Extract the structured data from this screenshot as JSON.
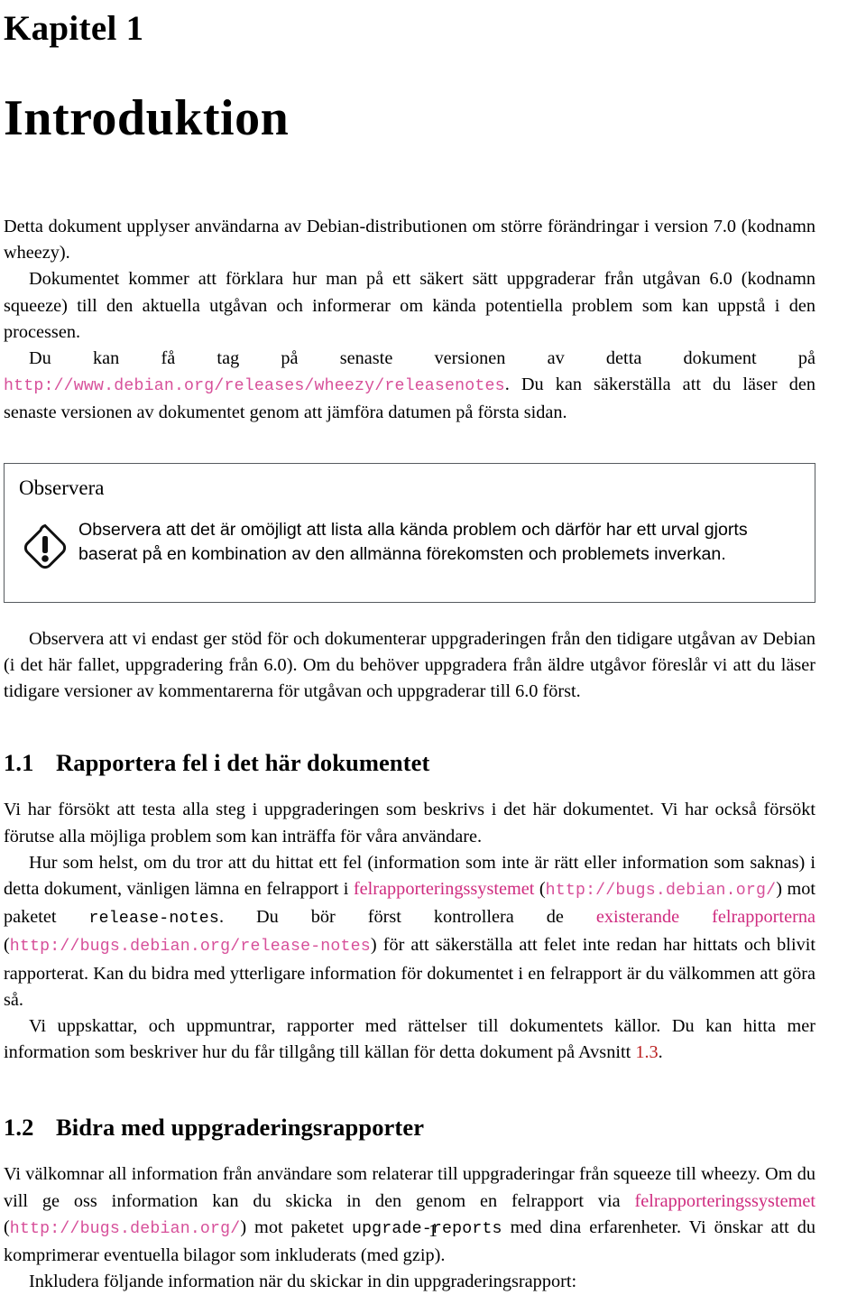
{
  "document": {
    "language": "sv",
    "chapter_label": "Kapitel 1",
    "chapter_title": "Introduktion",
    "page_number": "1"
  },
  "colors": {
    "text": "#000000",
    "url_mono": "#d7509a",
    "link_serif": "#cf2b7f",
    "xref": "#bb2222",
    "note_border": "#555a5e",
    "background": "#ffffff"
  },
  "intro": {
    "para1": {
      "text": "Detta dokument upplyser användarna av Debian-distributionen om större förändringar i version 7.0 (kodnamn wheezy)."
    },
    "para2": {
      "text": "Dokumentet kommer att förklara hur man på ett säkert sätt uppgraderar från utgåvan 6.0 (kodnamn squeeze) till den aktuella utgåvan och informerar om kända potentiella problem som kan uppstå i den processen."
    },
    "para3": {
      "before_url": "Du kan få tag på senaste versionen av detta dokument på ",
      "url": "http://www.debian.org/releases/wheezy/releasenotes",
      "after_url": ". Du kan säkerställa att du läser den senaste versionen av dokumentet genom att jämföra datumen på första sidan."
    }
  },
  "note": {
    "icon_name": "warning-diamond-icon",
    "title": "Observera",
    "body": "Observera att det är omöjligt att lista alla kända problem och därför har ett urval gjorts baserat på en kombination av den allmänna förekomsten och problemets inverkan."
  },
  "after_note": {
    "para": "Observera att vi endast ger stöd för och dokumenterar uppgraderingen från den tidigare utgåvan av Debian (i det här fallet, uppgradering från 6.0). Om du behöver uppgradera från äldre utgåvor föreslår vi att du läser tidigare versioner av kommentarerna för utgåvan och uppgraderar till 6.0 först."
  },
  "section_1_1": {
    "number": "1.1",
    "title": "Rapportera fel i det här dokumentet",
    "para1": "Vi har försökt att testa alla steg i uppgraderingen som beskrivs i det här dokumentet. Vi har också försökt förutse alla möjliga problem som kan inträffa för våra användare.",
    "para2": {
      "seg1": "Hur som helst, om du tror att du hittat ett fel (information som inte är rätt eller information som saknas) i detta dokument, vänligen lämna en felrapport i ",
      "link1": "felrapporteringssystemet",
      "seg2": " (",
      "url1": "http://bugs.debian.org/",
      "seg3": ") mot paketet ",
      "mono1": "release-notes",
      "seg4": ". Du bör först kontrollera de ",
      "link2": "existerande felrapporterna",
      "seg5": " (",
      "url2": "http://bugs.debian.org/release-notes",
      "seg6": ") för att säkerställa att felet inte redan har hittats och blivit rapporterat. Kan du bidra med ytterligare information för dokumentet i en felrapport är du välkommen att göra så."
    },
    "para3": {
      "seg1": "Vi uppskattar, och uppmuntrar, rapporter med rättelser till dokumentets källor. Du kan hitta mer information som beskriver hur du får tillgång till källan för detta dokument på Avsnitt ",
      "xref": "1.3",
      "seg2": "."
    }
  },
  "section_1_2": {
    "number": "1.2",
    "title": "Bidra med uppgraderingsrapporter",
    "para1": {
      "seg1": "Vi välkomnar all information från användare som relaterar till uppgraderingar från squeeze till wheezy. Om du vill ge oss information kan du skicka in den genom en felrapport via ",
      "link1": "felrapporteringssystemet",
      "seg2": " (",
      "url1": "http://bugs.debian.org/",
      "seg3": ") mot paketet ",
      "mono1": "upgrade-reports",
      "seg4": " med dina erfarenheter. Vi önskar att du komprimerar eventuella bilagor som inkluderats (med gzip)."
    },
    "para2": "Inkludera följande information när du skickar in din uppgraderingsrapport:"
  }
}
